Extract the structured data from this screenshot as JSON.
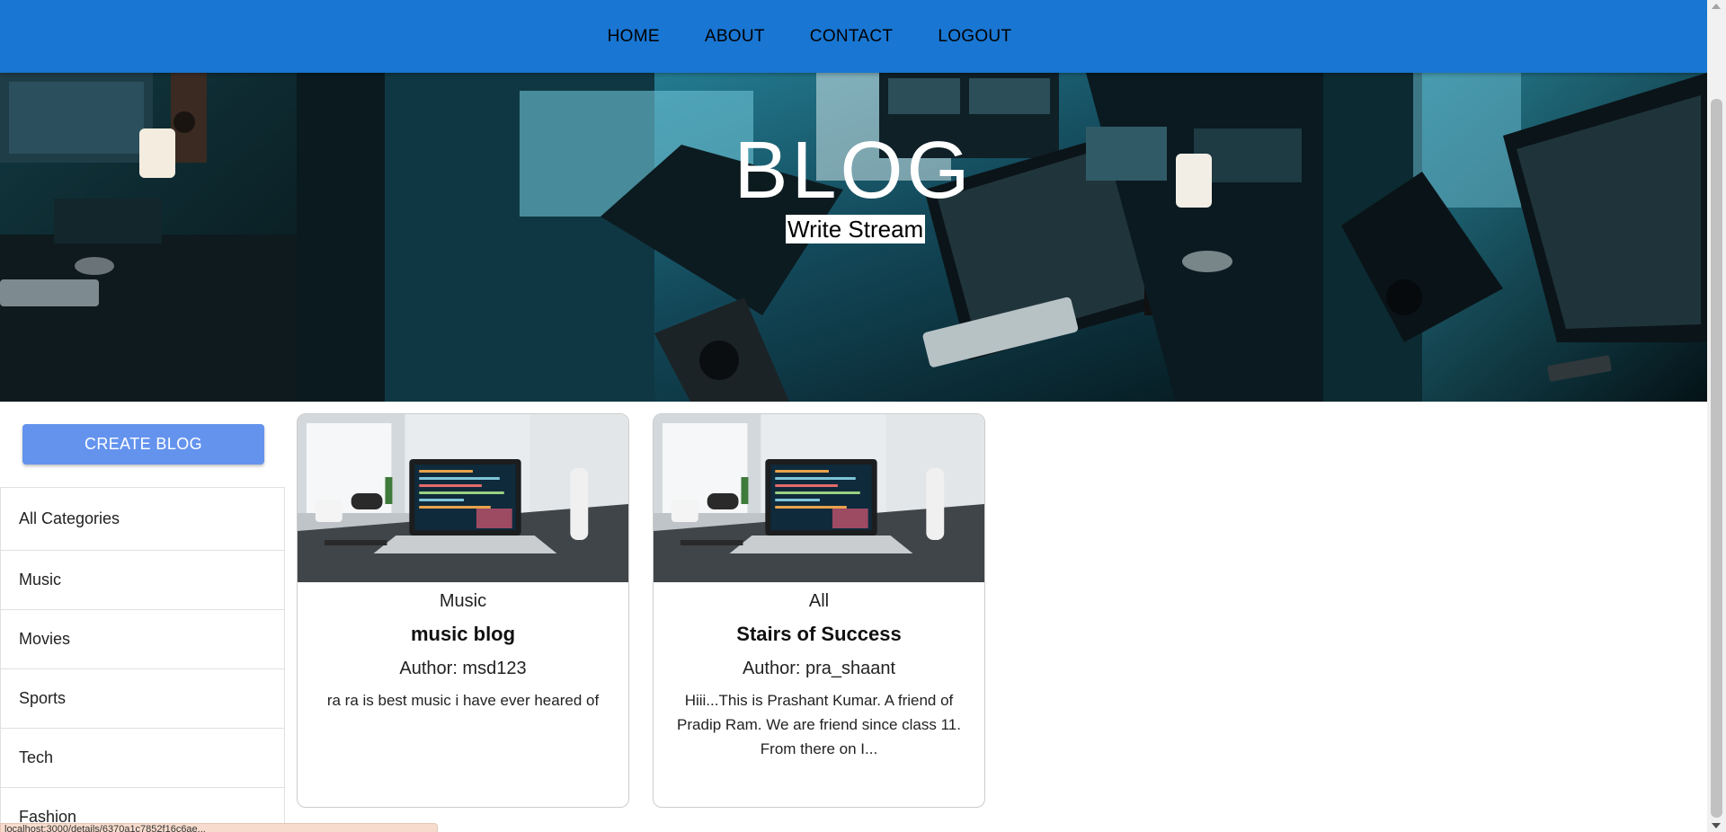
{
  "nav": {
    "items": [
      "HOME",
      "ABOUT",
      "CONTACT",
      "LOGOUT"
    ]
  },
  "banner": {
    "title": "BLOG",
    "subtitle": "Write Stream"
  },
  "sidebar": {
    "create_label": "CREATE BLOG",
    "categories": [
      "All Categories",
      "Music",
      "Movies",
      "Sports",
      "Tech",
      "Fashion"
    ]
  },
  "posts": [
    {
      "category": "Music",
      "title": "music blog",
      "author": "Author: msd123",
      "description": "ra ra is best music i have ever heared of"
    },
    {
      "category": "All",
      "title": "Stairs of Success",
      "author": "Author: pra_shaant",
      "description": "Hiii...This is Prashant Kumar. A friend of Pradip Ram. We are friend since class 11. From there on I..."
    }
  ],
  "status_bar": {
    "text": "localhost:3000/details/6370a1c7852f16c6ae..."
  },
  "colors": {
    "nav_bg": "#1976d2",
    "create_button": "#6493ee",
    "banner_dark": "#0b2229"
  }
}
